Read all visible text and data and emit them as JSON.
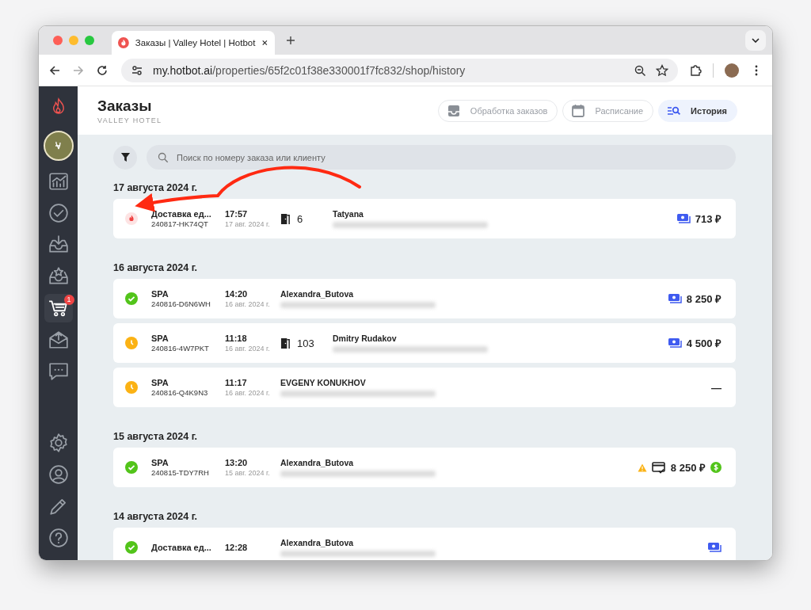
{
  "browser": {
    "tab_title": "Заказы | Valley Hotel | Hotbot",
    "url_host": "my.hotbot.ai",
    "url_path": "/properties/65f2c01f38e330001f7fc832/shop/history"
  },
  "sidebar": {
    "items": [
      {
        "kind": "chart",
        "selected": false
      },
      {
        "kind": "check",
        "selected": false
      },
      {
        "kind": "inbox",
        "selected": false
      },
      {
        "kind": "star",
        "selected": false
      },
      {
        "kind": "cart",
        "selected": true,
        "badge": "1"
      },
      {
        "kind": "mail",
        "selected": false
      },
      {
        "kind": "chat",
        "selected": false
      }
    ],
    "bottom_items": [
      {
        "kind": "gear"
      },
      {
        "kind": "user"
      },
      {
        "kind": "pencil"
      },
      {
        "kind": "help"
      }
    ]
  },
  "header": {
    "title": "Заказы",
    "subtitle": "VALLEY HOTEL"
  },
  "tabs": [
    {
      "label": "Обработка заказов",
      "kind": "inbox",
      "selected": false
    },
    {
      "label": "Расписание",
      "kind": "calendar",
      "selected": false
    },
    {
      "label": "История",
      "kind": "history",
      "selected": true
    }
  ],
  "search": {
    "placeholder": "Поиск по номеру заказа или клиенту"
  },
  "groups": [
    {
      "date": "17 августа 2024 г.",
      "orders": [
        {
          "status": {
            "kind": "new"
          },
          "title": "Доставка ед...",
          "number": "240817-HK74QT",
          "time": "17:57",
          "date": "17 авг. 2024 г.",
          "room": "6",
          "name": "Tatyana",
          "payment": {
            "kind": "cash"
          },
          "amount": "713 ₽",
          "warning": false,
          "paid": false
        }
      ]
    },
    {
      "date": "16 августа 2024 г.",
      "orders": [
        {
          "status": {
            "kind": "done"
          },
          "title": "SPA",
          "number": "240816-D6N6WH",
          "time": "14:20",
          "date": "16 авг. 2024 г.",
          "name": "Alexandra_Butova",
          "payment": {
            "kind": "cash"
          },
          "amount": "8 250 ₽",
          "warning": false,
          "paid": false
        },
        {
          "status": {
            "kind": "pending"
          },
          "title": "SPA",
          "number": "240816-4W7PKT",
          "time": "11:18",
          "date": "16 авг. 2024 г.",
          "room": "103",
          "name": "Dmitry Rudakov",
          "payment": {
            "kind": "cash"
          },
          "amount": "4 500 ₽",
          "warning": false,
          "paid": false
        },
        {
          "status": {
            "kind": "pending"
          },
          "title": "SPA",
          "number": "240816-Q4K9N3",
          "time": "11:17",
          "date": "16 авг. 2024 г.",
          "name": "EVGENY KONUKHOV",
          "payment": {
            "kind": "none"
          },
          "amount": "—",
          "warning": false,
          "paid": false
        }
      ]
    },
    {
      "date": "15 августа 2024 г.",
      "orders": [
        {
          "status": {
            "kind": "done"
          },
          "title": "SPA",
          "number": "240815-TDY7RH",
          "time": "13:20",
          "date": "15 авг. 2024 г.",
          "name": "Alexandra_Butova",
          "payment": {
            "kind": "card"
          },
          "amount": "8 250 ₽",
          "warning": true,
          "paid": true
        }
      ]
    },
    {
      "date": "14 августа 2024 г.",
      "orders": [
        {
          "status": {
            "kind": "done"
          },
          "title": "Доставка ед...",
          "time": "12:28",
          "name": "Alexandra_Butova",
          "payment": {
            "kind": "cash"
          }
        }
      ]
    }
  ]
}
